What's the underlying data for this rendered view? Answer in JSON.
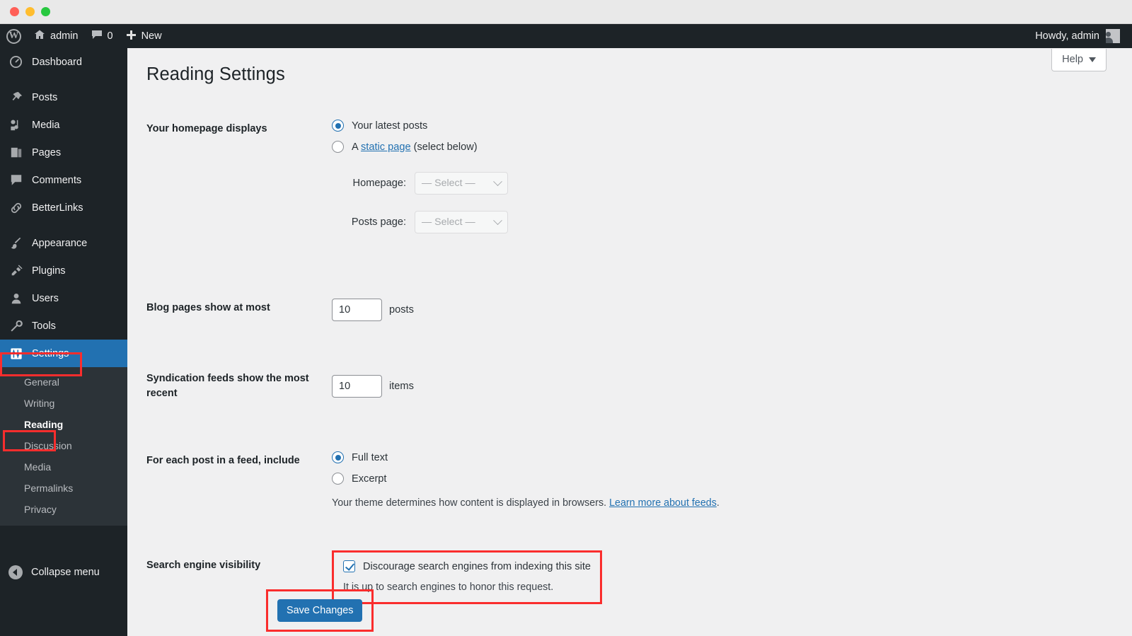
{
  "window": {
    "traffic_lights": [
      "close",
      "minimize",
      "maximize"
    ]
  },
  "admin_bar": {
    "wp_logo": "W",
    "site_name": "admin",
    "comments_count": "0",
    "new_label": "New",
    "howdy": "Howdy, admin"
  },
  "sidebar": {
    "items": [
      {
        "label": "Dashboard",
        "icon": "dashboard-icon"
      },
      {
        "label": "Posts",
        "icon": "pin-icon"
      },
      {
        "label": "Media",
        "icon": "media-icon"
      },
      {
        "label": "Pages",
        "icon": "pages-icon"
      },
      {
        "label": "Comments",
        "icon": "comment-icon"
      },
      {
        "label": "BetterLinks",
        "icon": "link-icon"
      },
      {
        "label": "Appearance",
        "icon": "brush-icon"
      },
      {
        "label": "Plugins",
        "icon": "plug-icon"
      },
      {
        "label": "Users",
        "icon": "user-icon"
      },
      {
        "label": "Tools",
        "icon": "wrench-icon"
      },
      {
        "label": "Settings",
        "icon": "settings-icon"
      }
    ],
    "submenu": [
      "General",
      "Writing",
      "Reading",
      "Discussion",
      "Media",
      "Permalinks",
      "Privacy"
    ],
    "active_submenu": "Reading",
    "collapse_label": "Collapse menu",
    "accent_color": "#2271b1",
    "background_color": "#1d2327"
  },
  "content": {
    "help_label": "Help",
    "page_title": "Reading Settings",
    "homepage_displays": {
      "label": "Your homepage displays",
      "option_latest": "Your latest posts",
      "option_static_prefix": "A ",
      "option_static_link": "static page",
      "option_static_suffix": " (select below)",
      "selected": "latest",
      "homepage_label": "Homepage:",
      "homepage_value": "— Select —",
      "posts_page_label": "Posts page:",
      "posts_page_value": "— Select —"
    },
    "blog_pages": {
      "label": "Blog pages show at most",
      "value": "10",
      "unit": "posts"
    },
    "syndication": {
      "label": "Syndication feeds show the most recent",
      "value": "10",
      "unit": "items"
    },
    "feed_include": {
      "label": "For each post in a feed, include",
      "option_full": "Full text",
      "option_excerpt": "Excerpt",
      "selected": "full",
      "description_prefix": "Your theme determines how content is displayed in browsers. ",
      "description_link": "Learn more about feeds",
      "description_suffix": "."
    },
    "search_visibility": {
      "label": "Search engine visibility",
      "checkbox_label": "Discourage search engines from indexing this site",
      "checked": true,
      "note": "It is up to search engines to honor this request."
    },
    "save_label": "Save Changes"
  },
  "highlights": {
    "color": "#fa2d2d",
    "targets": [
      "settings-menu",
      "reading-submenu",
      "search-visibility-field",
      "save-button"
    ]
  }
}
